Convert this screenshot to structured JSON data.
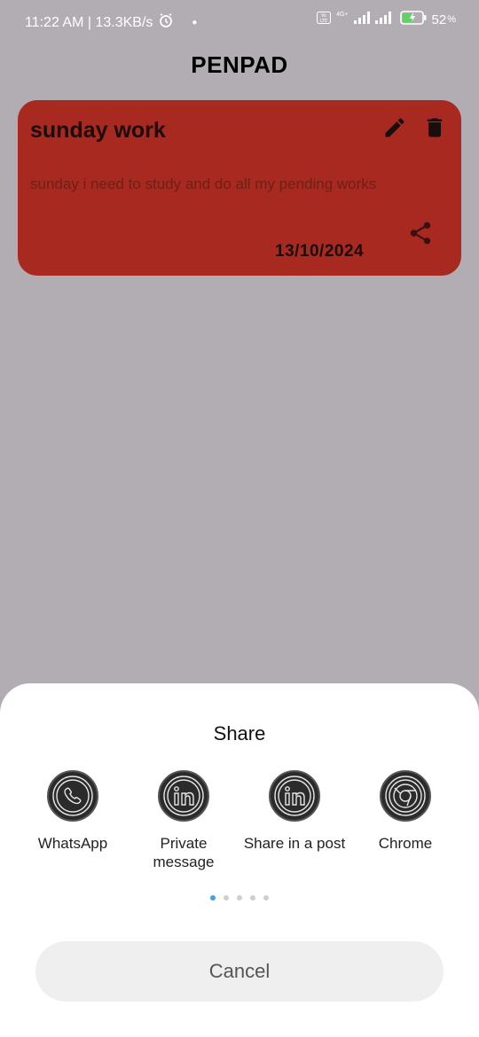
{
  "status_bar": {
    "time_speed": "11:22 AM | 13.3KB/s",
    "network": "4G+",
    "battery": "52"
  },
  "app": {
    "title": "PENPAD"
  },
  "note": {
    "title": "sunday work",
    "body": "sunday i need to study and do all my pending works",
    "date": "13/10/2024",
    "color": "#a8291f"
  },
  "share_sheet": {
    "title": "Share",
    "targets": [
      {
        "label": "WhatsApp",
        "icon": "whatsapp-icon"
      },
      {
        "label": "Private message",
        "icon": "linkedin-icon"
      },
      {
        "label": "Share in a post",
        "icon": "linkedin-icon"
      },
      {
        "label": "Chrome",
        "icon": "chrome-icon"
      }
    ],
    "page_count": 5,
    "active_page": 1,
    "cancel_label": "Cancel"
  }
}
